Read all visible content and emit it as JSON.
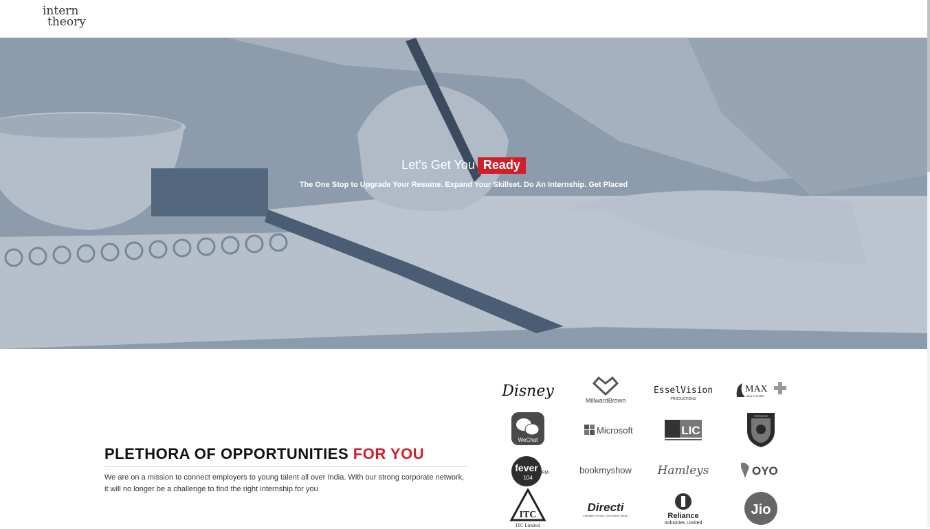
{
  "brand": {
    "line1": "intern",
    "line2": "theory"
  },
  "hero": {
    "title_pre": "Let’s Get You",
    "title_highlight": "Ready",
    "subtitle": "The One Stop to Upgrade Your Resume. Expand Your Skillset. Do An Internship. Get Placed"
  },
  "opportunities": {
    "heading_black": "PLETHORA OF OPPORTUNITIES",
    "heading_red": "FOR YOU",
    "body": "We are on a mission to connect employers to young talent all over India. With our strong corporate network, it will no longer be a challenge to find the right internship for you"
  },
  "partners": [
    {
      "name": "Disney",
      "label": "Disney"
    },
    {
      "name": "MillwardBrown",
      "label": "MillwardBrown"
    },
    {
      "name": "EsselVision",
      "label": "EsselVision",
      "sub": "PRODUCTIONS"
    },
    {
      "name": "Max Healthcare",
      "label": "MAX",
      "sub": "HEALTHCARE"
    },
    {
      "name": "WeChat",
      "label": "WeChat"
    },
    {
      "name": "Microsoft",
      "label": "Microsoft"
    },
    {
      "name": "LIC",
      "label": "LIC"
    },
    {
      "name": "Porsche",
      "label": "PORSCHE"
    },
    {
      "name": "Fever 104 FM",
      "label": "fever",
      "sub": "104"
    },
    {
      "name": "BookMyShow",
      "label": "bookmyshow"
    },
    {
      "name": "Hamleys",
      "label": "Hamleys"
    },
    {
      "name": "OYO",
      "label": "OYO"
    },
    {
      "name": "ITC Limited",
      "label": "ITC Limited"
    },
    {
      "name": "Directi",
      "label": "Directi",
      "sub": "Intelligent People. Uncommon Ideas."
    },
    {
      "name": "Reliance",
      "label": "Reliance",
      "sub": "Industries Limited"
    },
    {
      "name": "Jio",
      "label": "Jio"
    }
  ],
  "colors": {
    "accent": "#d11f2a",
    "text": "#111111"
  }
}
